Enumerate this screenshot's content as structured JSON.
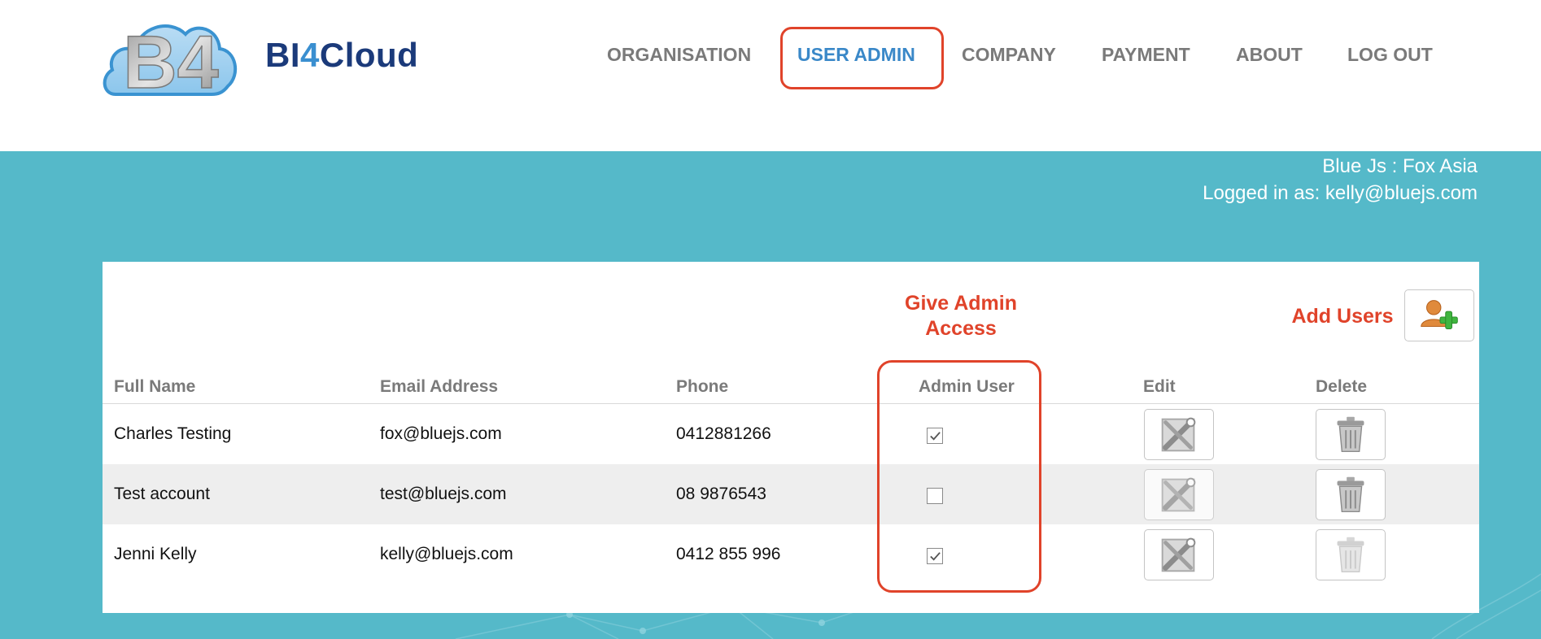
{
  "brand": {
    "name_prefix": "BI",
    "name_four": "4",
    "name_suffix": "Cloud",
    "logo_letters": "B4"
  },
  "nav": {
    "items": [
      "ORGANISATION",
      "USER ADMIN",
      "COMPANY",
      "PAYMENT",
      "ABOUT",
      "LOG OUT"
    ],
    "active": "USER ADMIN"
  },
  "account": {
    "org_line": "Blue Js : Fox Asia",
    "login_line": "Logged in as: kelly@bluejs.com"
  },
  "annotations": {
    "give_admin_line1": "Give Admin",
    "give_admin_line2": "Access",
    "add_users": "Add Users"
  },
  "table": {
    "headers": [
      "Full Name",
      "Email Address",
      "Phone",
      "Admin User",
      "Edit",
      "Delete"
    ],
    "rows": [
      {
        "name": "Charles Testing",
        "email": "fox@bluejs.com",
        "phone": "0412881266",
        "admin": true,
        "delete_enabled": true
      },
      {
        "name": "Test account",
        "email": "test@bluejs.com",
        "phone": "08 9876543",
        "admin": false,
        "delete_enabled": true
      },
      {
        "name": "Jenni Kelly",
        "email": "kelly@bluejs.com",
        "phone": "0412 855 996",
        "admin": true,
        "delete_enabled": false
      }
    ]
  },
  "icons": {
    "logo": "cloud-logo-icon",
    "add_user": "add-user-icon",
    "edit": "wrench-edit-icon",
    "delete": "trash-icon",
    "checkbox": "checkmark-icon"
  },
  "colors": {
    "brand_navy": "#1b3a7a",
    "brand_blue": "#3a8fd0",
    "nav_gray": "#7a7a7a",
    "nav_active": "#3a88c8",
    "band_teal": "#55b9c9",
    "annotation_red": "#e0432a",
    "row_alt": "#eeeeee"
  }
}
